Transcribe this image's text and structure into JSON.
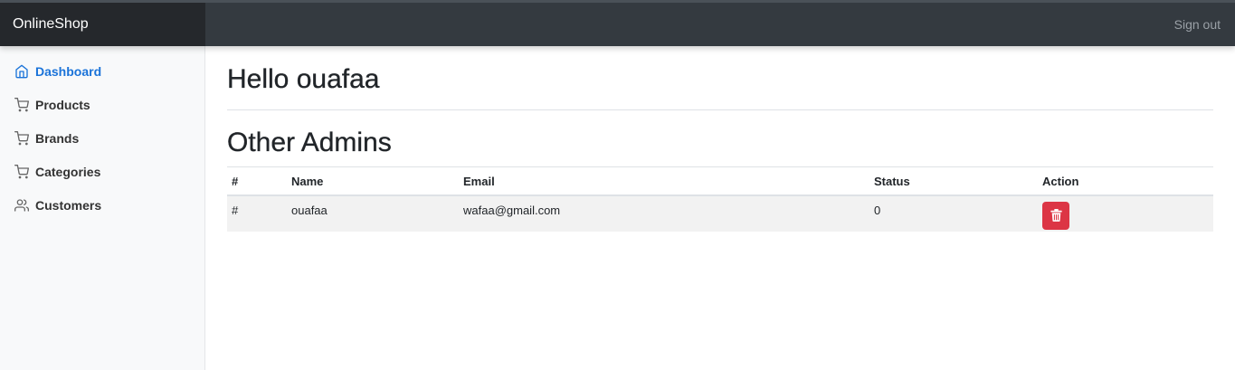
{
  "navbar": {
    "brand": "OnlineShop",
    "signout_label": "Sign out"
  },
  "sidebar": {
    "items": [
      {
        "label": "Dashboard",
        "icon": "home-icon",
        "active": true
      },
      {
        "label": "Products",
        "icon": "cart-icon",
        "active": false
      },
      {
        "label": "Brands",
        "icon": "cart-icon",
        "active": false
      },
      {
        "label": "Categories",
        "icon": "cart-icon",
        "active": false
      },
      {
        "label": "Customers",
        "icon": "users-icon",
        "active": false
      }
    ]
  },
  "main": {
    "greeting": "Hello ouafaa",
    "section_title": "Other Admins",
    "table": {
      "headers": [
        "#",
        "Name",
        "Email",
        "Status",
        "Action"
      ],
      "rows": [
        {
          "num": "#",
          "name": "ouafaa",
          "email": "wafaa@gmail.com",
          "status": "0",
          "action_icon": "trash-icon"
        }
      ]
    }
  },
  "colors": {
    "navbar_bg": "#343a40",
    "brand_bg": "#25282c",
    "active_link": "#1a73d9",
    "delete_button": "#dc3545",
    "row_bg": "#f2f2f2"
  }
}
